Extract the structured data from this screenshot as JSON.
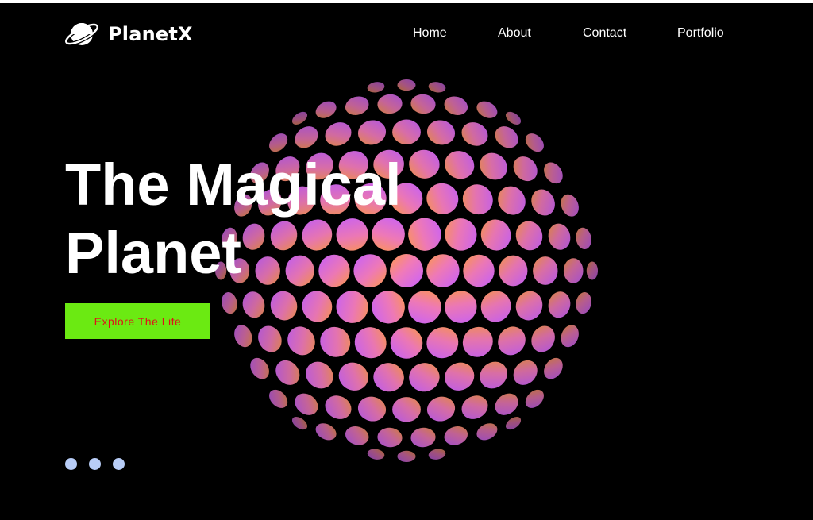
{
  "brand": {
    "name": "PlanetX",
    "logo_icon": "planet-ring-icon"
  },
  "nav": {
    "items": [
      {
        "label": "Home"
      },
      {
        "label": "About"
      },
      {
        "label": "Contact"
      },
      {
        "label": "Portfolio"
      }
    ]
  },
  "hero": {
    "title_line1": "The Magical",
    "title_line2": "Planet",
    "cta_label": "Explore The Life",
    "slides": 3,
    "active_slide": 1
  },
  "colors": {
    "background": "#000000",
    "text": "#ffffff",
    "cta_background": "#6bea12",
    "cta_text": "#e0101a",
    "dot": "#b8cdf7",
    "sphere_gradient_start": "#ff8a5c",
    "sphere_gradient_mid": "#f07ab8",
    "sphere_gradient_end": "#d070ff"
  }
}
